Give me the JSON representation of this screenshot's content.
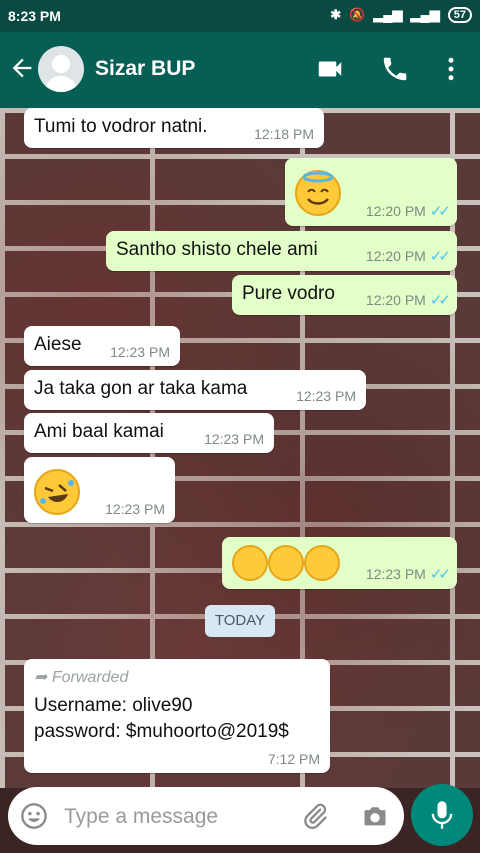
{
  "status_bar": {
    "time": "8:23 PM",
    "battery": "57"
  },
  "header": {
    "contact_name": "Sizar BUP"
  },
  "messages": [
    {
      "text": "Tumi to vodror natni.",
      "time": "12:18 PM"
    },
    {
      "time": "12:20 PM"
    },
    {
      "text": "Santho shisto chele ami",
      "time": "12:20 PM"
    },
    {
      "text": "Pure vodro",
      "time": "12:20 PM"
    },
    {
      "text": "Aiese",
      "time": "12:23 PM"
    },
    {
      "text": "Ja taka gon ar taka kama",
      "time": "12:23 PM"
    },
    {
      "text": "Ami baal kamai",
      "time": "12:23 PM"
    },
    {
      "time": "12:23 PM"
    },
    {
      "time": "12:23 PM"
    }
  ],
  "day_divider": "TODAY",
  "forwarded": {
    "label": "Forwarded",
    "line1": "Username: olive90",
    "line2": "password: $muhoorto@2019$",
    "time": "7:12 PM"
  },
  "input": {
    "placeholder": "Type a message"
  },
  "colors": {
    "header": "#075e54",
    "outgoing": "#e1ffc7",
    "mic": "#00897b"
  },
  "icons": [
    "back-arrow-icon",
    "avatar-icon",
    "video-call-icon",
    "phone-icon",
    "more-options-icon",
    "emoji-icon",
    "attachment-icon",
    "camera-icon",
    "mic-icon",
    "forward-icon",
    "read-ticks-icon"
  ]
}
